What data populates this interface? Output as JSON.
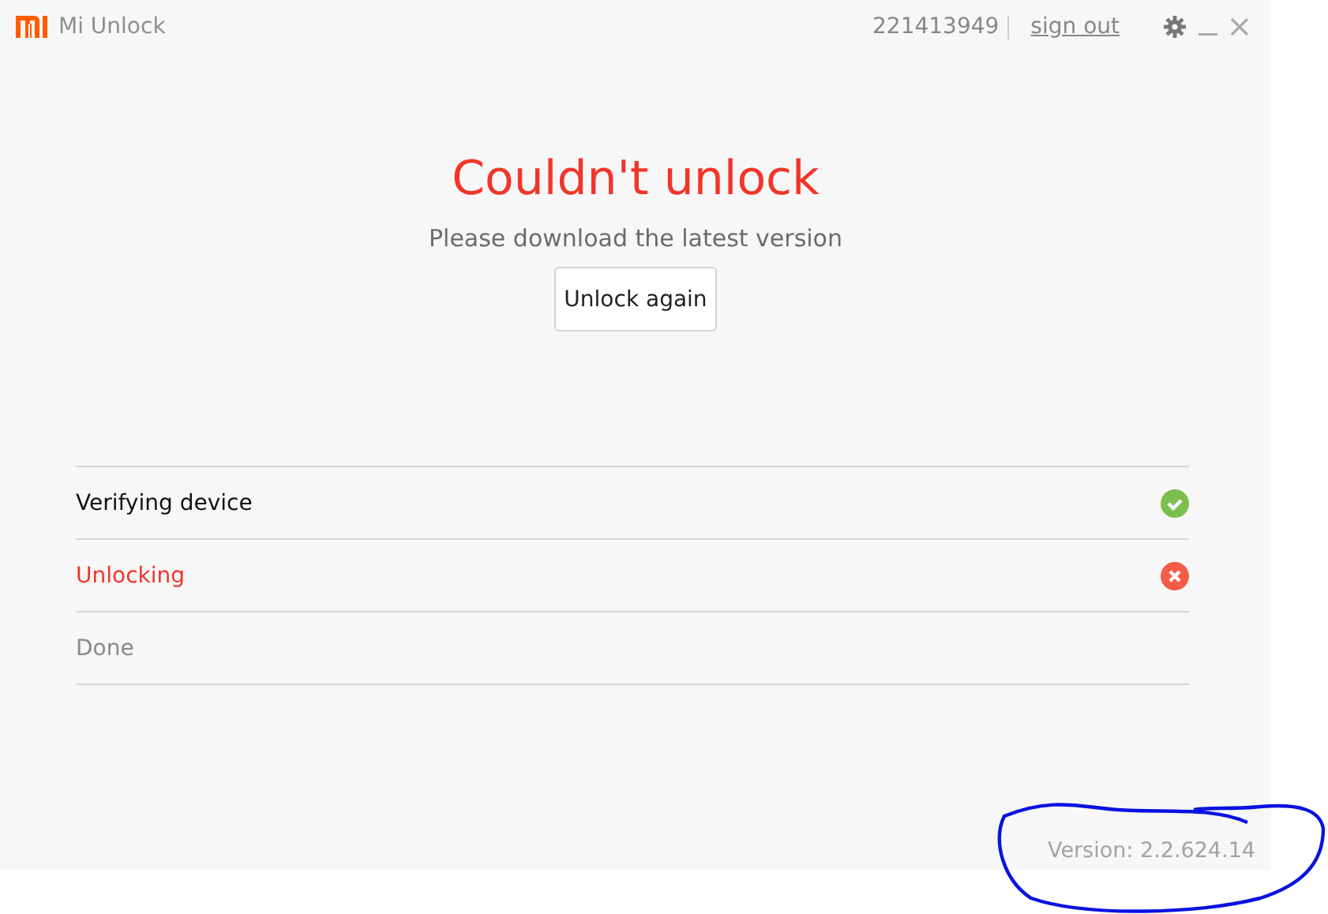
{
  "window": {
    "title": "Mi Unlock",
    "account": "221413949",
    "sign_out": "sign out"
  },
  "result": {
    "title": "Couldn't unlock",
    "message": "Please download the latest version",
    "button": "Unlock again"
  },
  "steps": [
    {
      "label": "Verifying device",
      "kind": "done"
    },
    {
      "label": "Unlocking",
      "kind": "failed"
    },
    {
      "label": "Done",
      "kind": "pending"
    }
  ],
  "version": "Version: 2.2.624.14"
}
